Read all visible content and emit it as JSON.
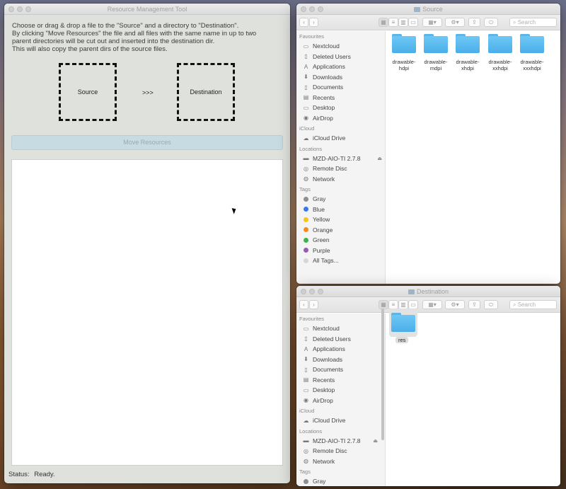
{
  "tool": {
    "title": "Resource Management Tool",
    "intro": [
      "Choose or drag & drop a file to the \"Source\" and a directory to \"Destination\".",
      "By clicking \"Move Resources\" the file and all files with the same name in up to two",
      "parent directories will be cut out and inserted into the destination dir.",
      "This will also copy the parent dirs of the source files."
    ],
    "source_label": "Source",
    "arrow_label": ">>>",
    "destination_label": "Destination",
    "move_button": "Move Resources",
    "status_label": "Status:",
    "status_value": "Ready."
  },
  "finder_common": {
    "search_placeholder": "Search",
    "sections": {
      "favourites": "Favourites",
      "icloud": "iCloud",
      "locations": "Locations",
      "tags": "Tags"
    },
    "favourites": [
      "Nextcloud",
      "Deleted Users",
      "Applications",
      "Downloads",
      "Documents",
      "Recents",
      "Desktop",
      "AirDrop"
    ],
    "icloud": [
      "iCloud Drive"
    ],
    "locations": [
      "MZD-AIO-TI 2.7.8",
      "Remote Disc",
      "Network"
    ],
    "tags": [
      {
        "label": "Gray",
        "color": "#8e8e93"
      },
      {
        "label": "Blue",
        "color": "#3478f6"
      },
      {
        "label": "Yellow",
        "color": "#f5c518"
      },
      {
        "label": "Orange",
        "color": "#f58a1f"
      },
      {
        "label": "Green",
        "color": "#3ab54a"
      },
      {
        "label": "Purple",
        "color": "#9b59b6"
      },
      {
        "label": "All Tags...",
        "color": "#d6d6d6"
      }
    ]
  },
  "finder_source": {
    "title": "Source",
    "folders": [
      [
        "drawable-",
        "hdpi"
      ],
      [
        "drawable-",
        "mdpi"
      ],
      [
        "drawable-",
        "xhdpi"
      ],
      [
        "drawable-",
        "xxhdpi"
      ],
      [
        "drawable-",
        "xxxhdpi"
      ]
    ]
  },
  "finder_destination": {
    "title": "Destination",
    "folders": [
      "res"
    ]
  }
}
